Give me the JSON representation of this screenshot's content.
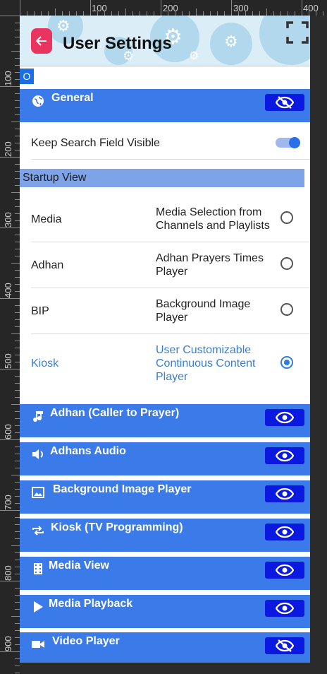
{
  "header": {
    "title": "User Settings",
    "back_icon": "arrow-left-icon",
    "fullscreen_icon": "fullscreen-icon",
    "accent": "#e8345f"
  },
  "search_badge": "O",
  "ruler": {
    "top_labels": [
      "100",
      "200",
      "300",
      "400"
    ],
    "left_labels": [
      "100",
      "200",
      "300",
      "400",
      "500",
      "600",
      "700",
      "800",
      "900"
    ]
  },
  "general": {
    "label": "General",
    "icon": "globe-icon",
    "toggle_icon": "eye-off-icon",
    "keep_search_label": "Keep Search Field Visible",
    "keep_search_on": true,
    "startup_view_title": "Startup View",
    "startup_options": [
      {
        "name": "Media",
        "description": "Media Selection from Channels and Playlists",
        "selected": false
      },
      {
        "name": "Adhan",
        "description": "Adhan Prayers Times Player",
        "selected": false
      },
      {
        "name": "BIP",
        "description": "Background Image Player",
        "selected": false
      },
      {
        "name": "Kiosk",
        "description": "User Customizable Continuous Content Player",
        "selected": true
      }
    ]
  },
  "sections": [
    {
      "label": "Adhan (Caller to Prayer)",
      "icon": "music-note-icon",
      "toggle_icon": "eye-icon"
    },
    {
      "label": "Adhans Audio",
      "icon": "speaker-icon",
      "toggle_icon": "eye-icon"
    },
    {
      "label": "Background Image Player",
      "icon": "image-icon",
      "toggle_icon": "eye-icon"
    },
    {
      "label": "Kiosk (TV Programming)",
      "icon": "repeat-icon",
      "toggle_icon": "eye-icon"
    },
    {
      "label": "Media View",
      "icon": "film-icon",
      "toggle_icon": "eye-icon"
    },
    {
      "label": "Media Playback",
      "icon": "play-icon",
      "toggle_icon": "eye-icon"
    },
    {
      "label": "Video Player",
      "icon": "videocam-icon",
      "toggle_icon": "eye-off-icon"
    }
  ],
  "colors": {
    "section_bg": "#3a7be9",
    "toggle_button_bg": "#0b19e0",
    "selected_text": "#3a7fd0",
    "subhead_bg": "#7ea3e8"
  }
}
